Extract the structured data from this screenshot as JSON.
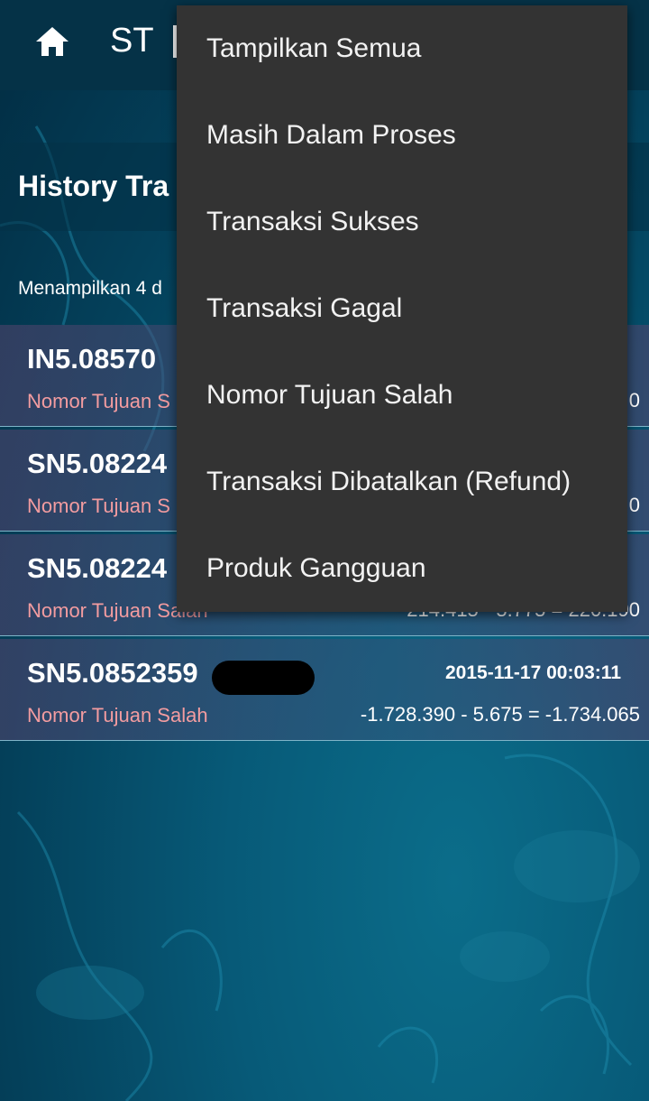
{
  "appbar": {
    "home_icon": "home-icon",
    "title": "ST"
  },
  "page": {
    "title": "History Tra",
    "info": "Menampilkan 4 d"
  },
  "transactions": [
    {
      "id": "IN5.08570",
      "date": "",
      "status": "Nomor Tujuan S",
      "amount": "0"
    },
    {
      "id": "SN5.08224",
      "date": "",
      "status": "Nomor Tujuan S",
      "amount": "0"
    },
    {
      "id": "SN5.08224",
      "date": "",
      "status": "Nomor Tujuan Salah",
      "amount": "214.415 - 5.775 = 220.190"
    },
    {
      "id": "SN5.0852359",
      "date": "2015-11-17 00:03:11",
      "status": "Nomor Tujuan Salah",
      "amount": "-1.728.390 - 5.675 = -1.734.065"
    }
  ],
  "menu": {
    "items": [
      "Tampilkan Semua",
      "Masih Dalam Proses",
      "Transaksi Sukses",
      "Transaksi Gagal",
      "Nomor Tujuan Salah",
      "Transaksi Dibatalkan (Refund)",
      "Produk Gangguan"
    ]
  },
  "colors": {
    "appbar": "#053247",
    "menu_bg": "#333333",
    "status_text": "#f39ca0"
  }
}
